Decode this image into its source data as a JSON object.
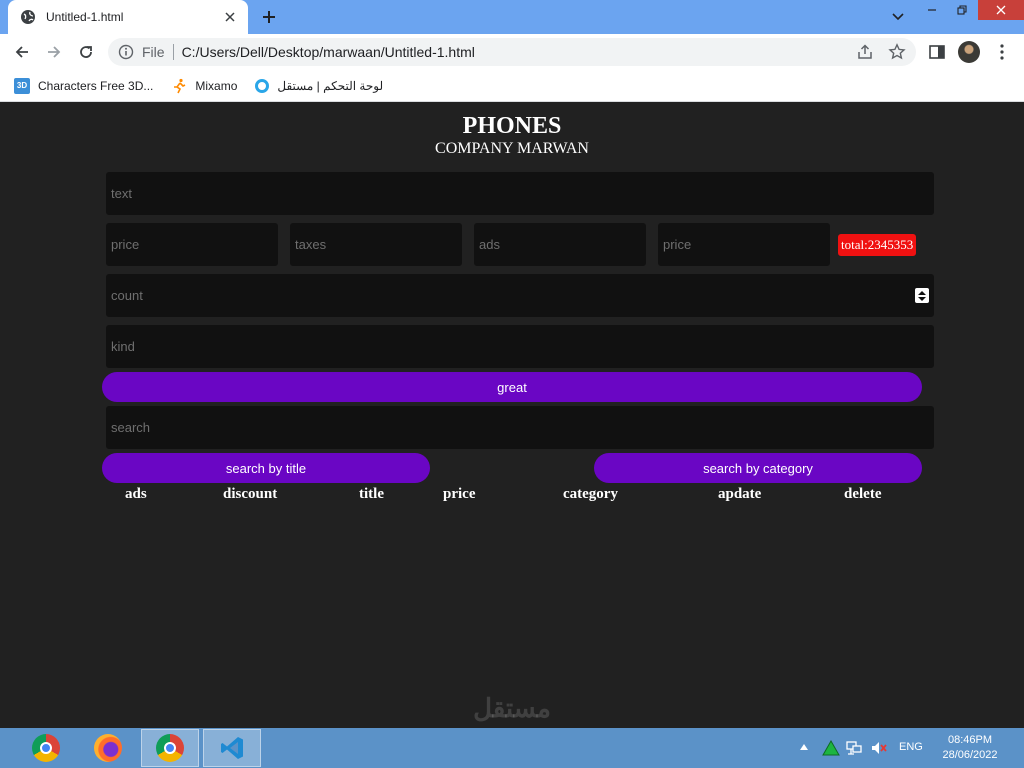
{
  "browser": {
    "tab_title": "Untitled-1.html",
    "omnibox_scheme": "File",
    "url": "C:/Users/Dell/Desktop/marwaan/Untitled-1.html",
    "bookmarks": [
      {
        "label": "Characters Free 3D...",
        "icon_text": "3D"
      },
      {
        "label": "Mixamo"
      },
      {
        "label": "لوحة التحكم | مستقل"
      }
    ]
  },
  "page": {
    "title": "PHONES",
    "subtitle": "COMPANY MARWAN",
    "inputs": {
      "text_placeholder": "text",
      "price_placeholder": "price",
      "taxes_placeholder": "taxes",
      "ads_placeholder": "ads",
      "price2_placeholder": "price",
      "count_placeholder": "count",
      "kind_placeholder": "kind",
      "search_placeholder": "search"
    },
    "total_label": "total:2345353",
    "buttons": {
      "create": "great",
      "search_title": "search by title",
      "search_category": "search by category"
    },
    "table_headers": [
      "ads",
      "discount",
      "title",
      "price",
      "category",
      "apdate",
      "delete"
    ],
    "watermark": "مستقل",
    "colors": {
      "background": "#212121",
      "input_bg": "#111111",
      "accent_button": "#6a06c4",
      "total_badge": "#f01111"
    }
  },
  "taskbar": {
    "language": "ENG",
    "time": "08:46PM",
    "date": "28/06/2022",
    "apps": [
      "chrome-icon",
      "firefox-icon",
      "chrome-profile-icon",
      "vscode-icon"
    ]
  }
}
